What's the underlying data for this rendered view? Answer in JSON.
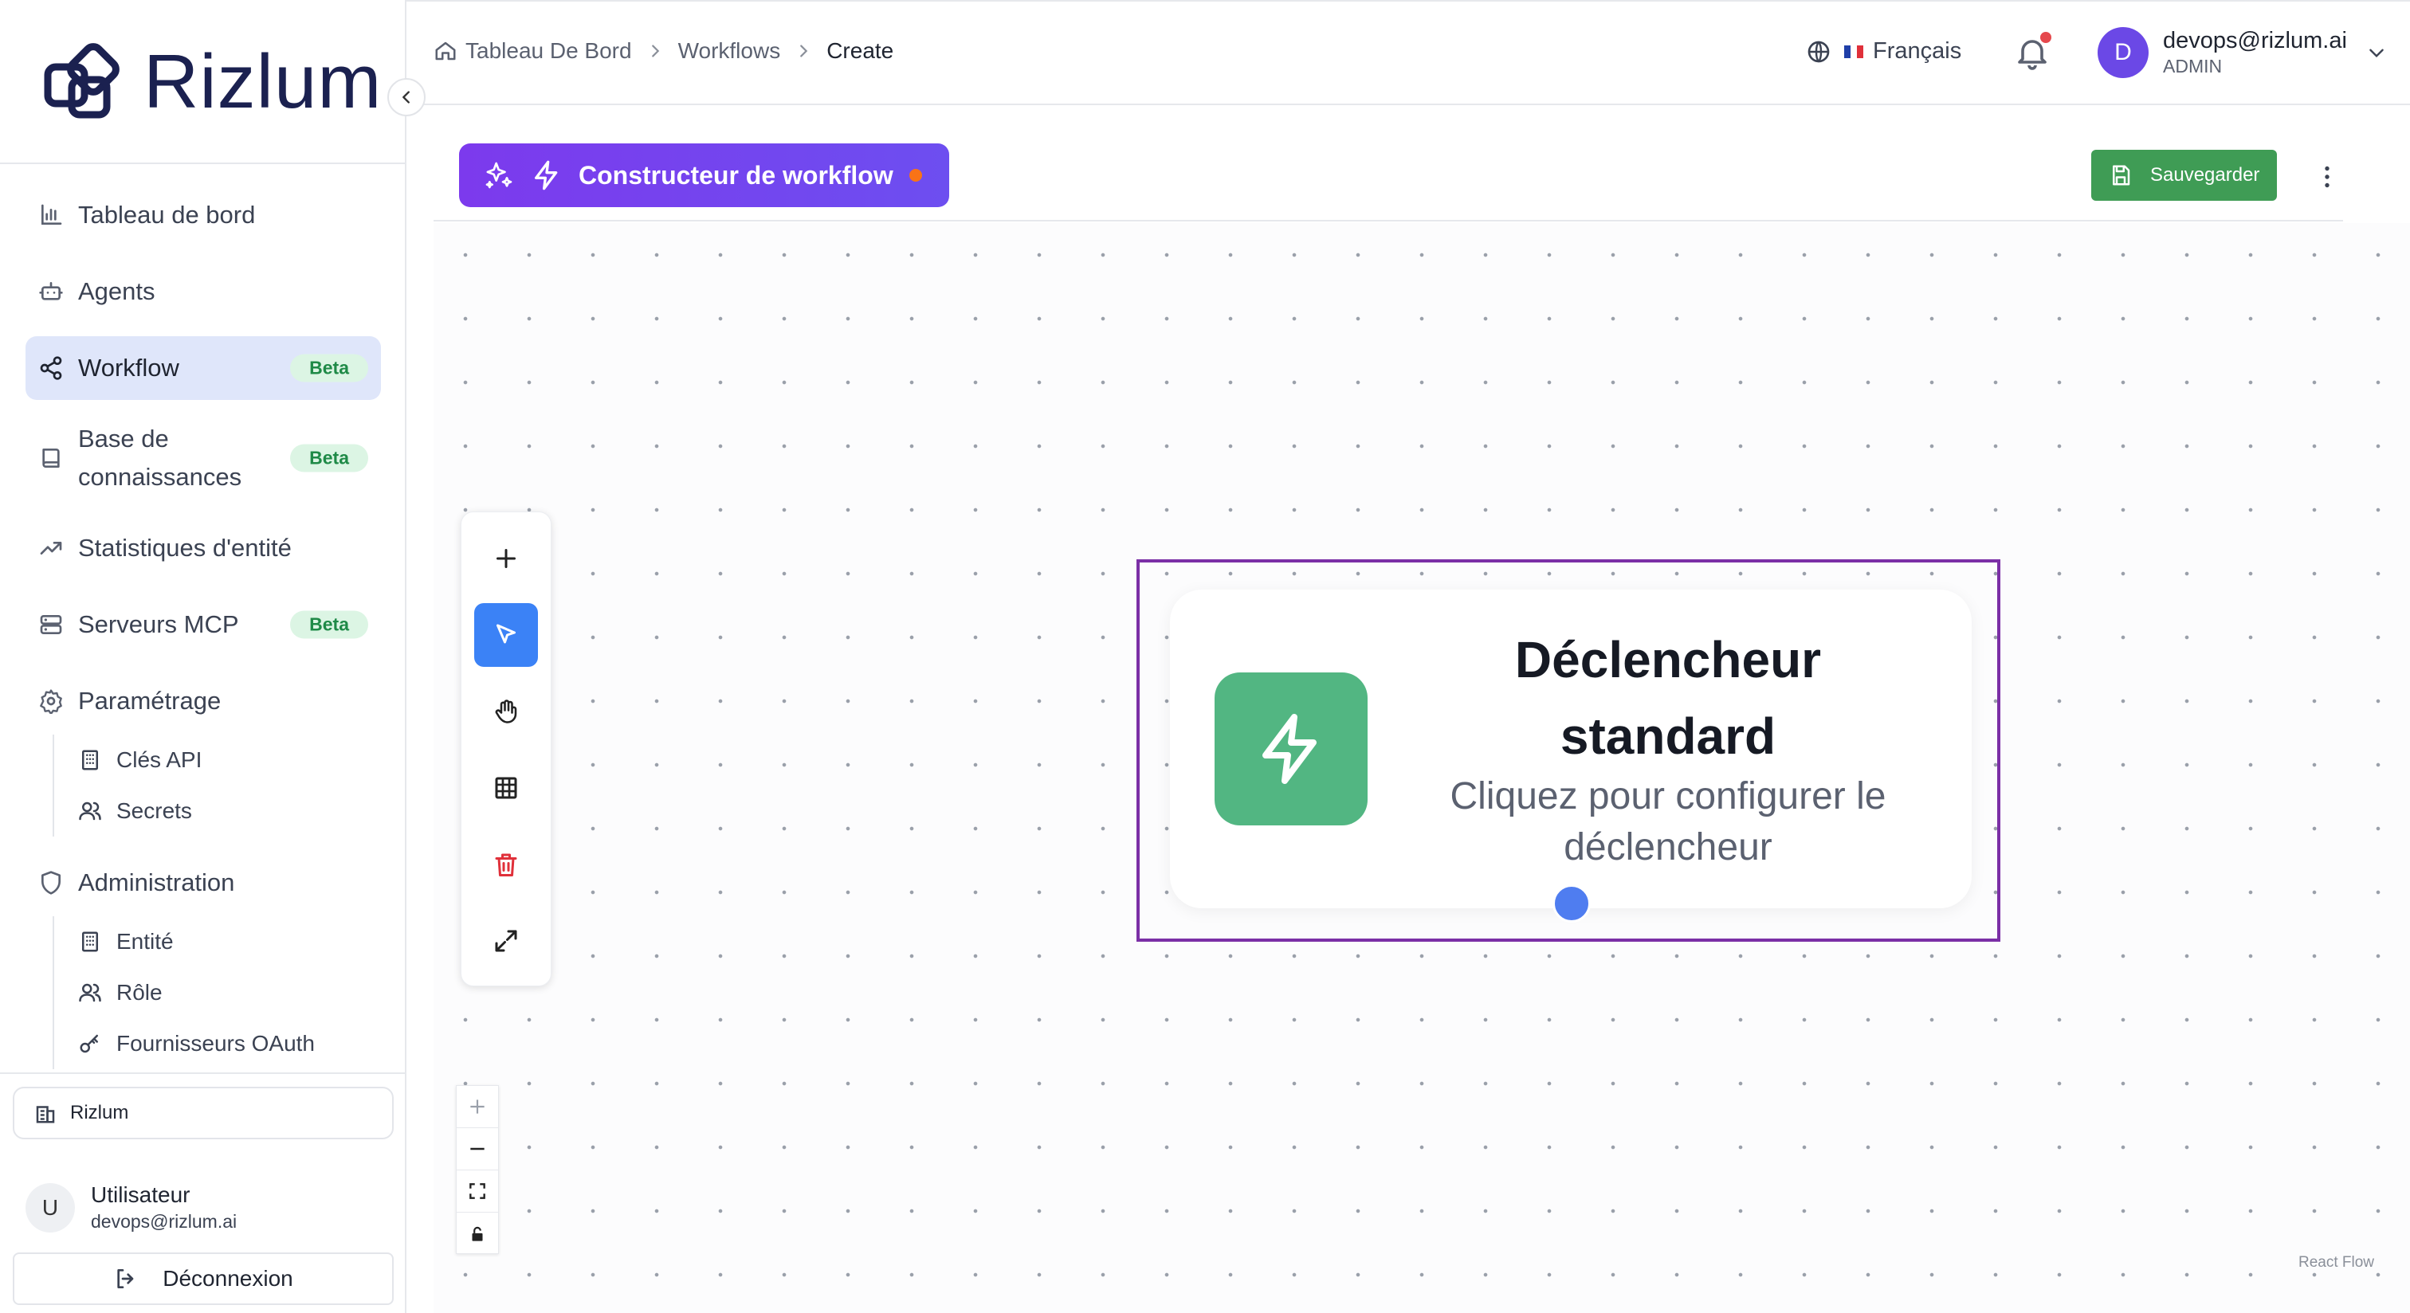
{
  "brand": {
    "name": "Rizlum",
    "color": "#1b2150"
  },
  "sidebar": {
    "items": [
      {
        "label": "Tableau de bord",
        "icon": "bar-chart-icon"
      },
      {
        "label": "Agents",
        "icon": "bot-icon"
      },
      {
        "label": "Workflow",
        "icon": "share-nodes-icon",
        "badge": "Beta",
        "active": true
      },
      {
        "label": "Base de connaissances",
        "icon": "book-icon",
        "badge": "Beta"
      },
      {
        "label": "Statistiques d'entité",
        "icon": "trending-up-icon"
      },
      {
        "label": "Serveurs MCP",
        "icon": "server-icon",
        "badge": "Beta"
      },
      {
        "label": "Paramétrage",
        "icon": "gear-icon"
      },
      {
        "label": "Administration",
        "icon": "shield-icon"
      }
    ],
    "settings_sub": [
      {
        "label": "Clés API",
        "icon": "building-icon"
      },
      {
        "label": "Secrets",
        "icon": "users-icon"
      }
    ],
    "admin_sub": [
      {
        "label": "Entité",
        "icon": "building-icon"
      },
      {
        "label": "Rôle",
        "icon": "users-icon"
      },
      {
        "label": "Fournisseurs OAuth",
        "icon": "key-icon"
      }
    ],
    "org": "Rizlum",
    "user": {
      "initial": "U",
      "name": "Utilisateur",
      "email": "devops@rizlum.ai"
    },
    "logout_label": "Déconnexion"
  },
  "header": {
    "breadcrumb": [
      "Tableau De Bord",
      "Workflows",
      "Create"
    ],
    "language": "Français",
    "account": {
      "initial": "D",
      "email": "devops@rizlum.ai",
      "role": "ADMIN"
    }
  },
  "workflow": {
    "title": "Constructeur de workflow",
    "save_label": "Sauvegarder",
    "accent": "#7c3aed",
    "save_color": "#3f9c55",
    "unsaved_dot_color": "#f97316"
  },
  "canvas": {
    "tools": [
      "plus-icon",
      "pointer-icon",
      "hand-icon",
      "grid-icon",
      "trash-icon",
      "expand-icon"
    ],
    "active_tool": "pointer-icon",
    "zoom_controls": [
      "zoom-in-icon",
      "zoom-out-icon",
      "fit-view-icon",
      "lock-icon"
    ],
    "node": {
      "title": "Déclencheur standard",
      "subtitle": "Cliquez pour configurer le déclencheur",
      "icon": "lightning-icon",
      "icon_bg": "#52b682"
    },
    "attribution": "React Flow"
  }
}
